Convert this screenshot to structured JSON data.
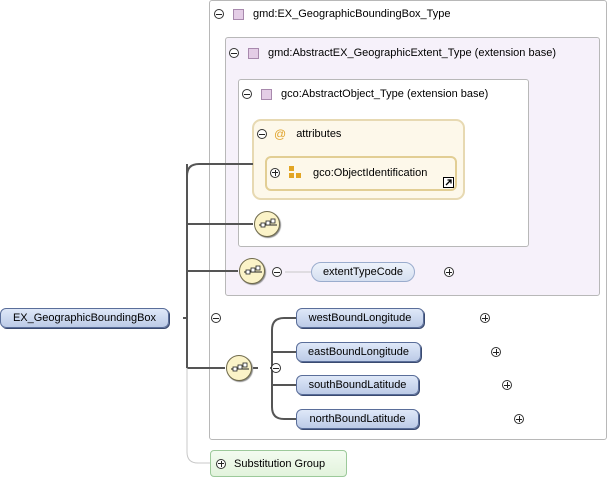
{
  "diagram": {
    "root_element": "EX_GeographicBoundingBox",
    "types": {
      "bounding_box_type": "gmd:EX_GeographicBoundingBox_Type",
      "extent_type": "gmd:AbstractEX_GeographicExtent_Type (extension base)",
      "object_type": "gco:AbstractObject_Type (extension base)"
    },
    "attributes": {
      "label": "attributes",
      "symbol": "@",
      "attribute_group": "gco:ObjectIdentification"
    },
    "extent_element": "extentTypeCode",
    "coordinate_elements": [
      "westBoundLongitude",
      "eastBoundLongitude",
      "southBoundLatitude",
      "northBoundLatitude"
    ],
    "substitution_group": "Substitution Group"
  },
  "colors": {
    "element_fill": "#c9d6ef",
    "element_border": "#5a6e9a",
    "type_box_fill": "#f6f1fa",
    "attribute_box_fill": "#fdf8ea",
    "sequence_fill": "#fbf3c8",
    "substitution_fill": "#e2f3dc",
    "connector": "#555555"
  },
  "icons": {
    "type": "complex-type-icon",
    "attributes": "at-sign-icon",
    "attribute_group": "attribute-group-icon",
    "sequence": "sequence-compositor-icon",
    "collapse": "collapse-icon",
    "expand": "expand-icon",
    "external_reference": "external-link-icon"
  }
}
